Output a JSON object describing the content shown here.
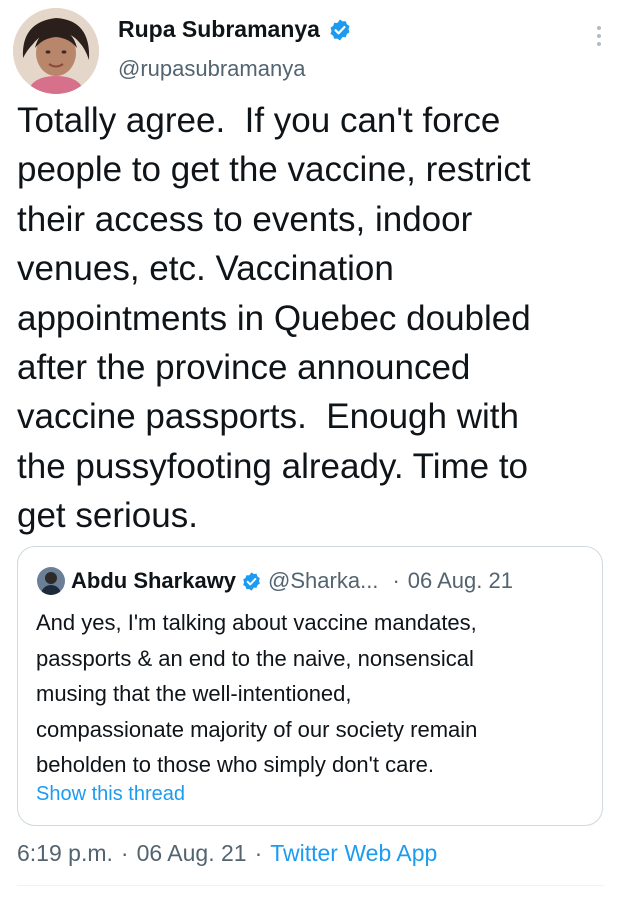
{
  "author": {
    "display_name": "Rupa Subramanya",
    "handle": "@rupasubramanya",
    "verified": true
  },
  "tweet": {
    "text": "Totally agree.  If you can't force\npeople to get the vaccine, restrict\ntheir access to events, indoor\nvenues, etc. Vaccination\nappointments in Quebec doubled\nafter the province announced\nvaccine passports.  Enough with\nthe pussyfooting already. Time to\nget serious."
  },
  "quoted_tweet": {
    "display_name": "Abdu Sharkawy",
    "handle": "@Sharka...",
    "separator": "·",
    "date": "06 Aug. 21",
    "text": "And yes, I'm talking about vaccine mandates,\npassports & an end to the naive, nonsensical\nmusing that the well-intentioned,\ncompassionate majority of our society remain\nbeholden to those who simply don't care.",
    "show_thread_label": "Show this thread"
  },
  "meta": {
    "time": "6:19 p.m.",
    "separator": "·",
    "date": "06 Aug. 21",
    "source": "Twitter Web App"
  },
  "colors": {
    "primary_text": "#0f1419",
    "secondary_text": "#536471",
    "accent": "#1d9bf0",
    "border": "#cfd9de"
  },
  "icons": {
    "verified": "verified-badge-icon",
    "more": "more-options-icon"
  }
}
